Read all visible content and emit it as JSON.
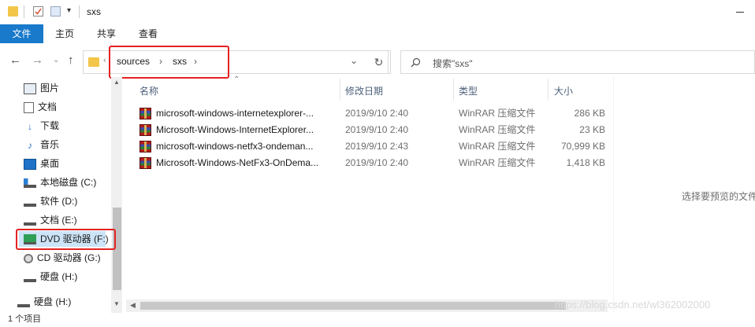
{
  "window": {
    "title": "sxs"
  },
  "ribbon": {
    "tabs": [
      "文件",
      "主页",
      "共享",
      "查看"
    ]
  },
  "address": {
    "breadcrumb": [
      "sources",
      "sxs"
    ]
  },
  "search": {
    "placeholder": "搜索\"sxs\""
  },
  "sidebar": {
    "items": [
      {
        "label": "图片",
        "icon": "pictures-icon"
      },
      {
        "label": "文档",
        "icon": "documents-icon"
      },
      {
        "label": "下载",
        "icon": "downloads-icon"
      },
      {
        "label": "音乐",
        "icon": "music-icon"
      },
      {
        "label": "桌面",
        "icon": "desktop-icon"
      },
      {
        "label": "本地磁盘 (C:)",
        "icon": "drive-c-icon"
      },
      {
        "label": "软件 (D:)",
        "icon": "drive-icon"
      },
      {
        "label": "文档 (E:)",
        "icon": "drive-icon"
      },
      {
        "label": "DVD 驱动器 (F:)",
        "icon": "dvd-drive-icon"
      },
      {
        "label": "CD 驱动器 (G:)",
        "icon": "cd-drive-icon"
      },
      {
        "label": "硬盘 (H:)",
        "icon": "drive-icon"
      }
    ],
    "extra_item": {
      "label": "硬盘 (H:)",
      "icon": "drive-icon"
    },
    "footer": "1 个项目"
  },
  "columns": {
    "name": "名称",
    "date": "修改日期",
    "type": "类型",
    "size": "大小"
  },
  "files": [
    {
      "name": "microsoft-windows-internetexplorer-...",
      "date": "2019/9/10 2:40",
      "type": "WinRAR 压缩文件",
      "size": "286 KB"
    },
    {
      "name": "Microsoft-Windows-InternetExplorer...",
      "date": "2019/9/10 2:40",
      "type": "WinRAR 压缩文件",
      "size": "23 KB"
    },
    {
      "name": "microsoft-windows-netfx3-ondeman...",
      "date": "2019/9/10 2:43",
      "type": "WinRAR 压缩文件",
      "size": "70,999 KB"
    },
    {
      "name": "Microsoft-Windows-NetFx3-OnDema...",
      "date": "2019/9/10 2:40",
      "type": "WinRAR 压缩文件",
      "size": "1,418 KB"
    }
  ],
  "preview": {
    "text": "选择要预览的文件"
  },
  "watermark": "https://blog.csdn.net/wl362002000",
  "colors": {
    "accent": "#1979ca",
    "highlight": "#e52222"
  }
}
